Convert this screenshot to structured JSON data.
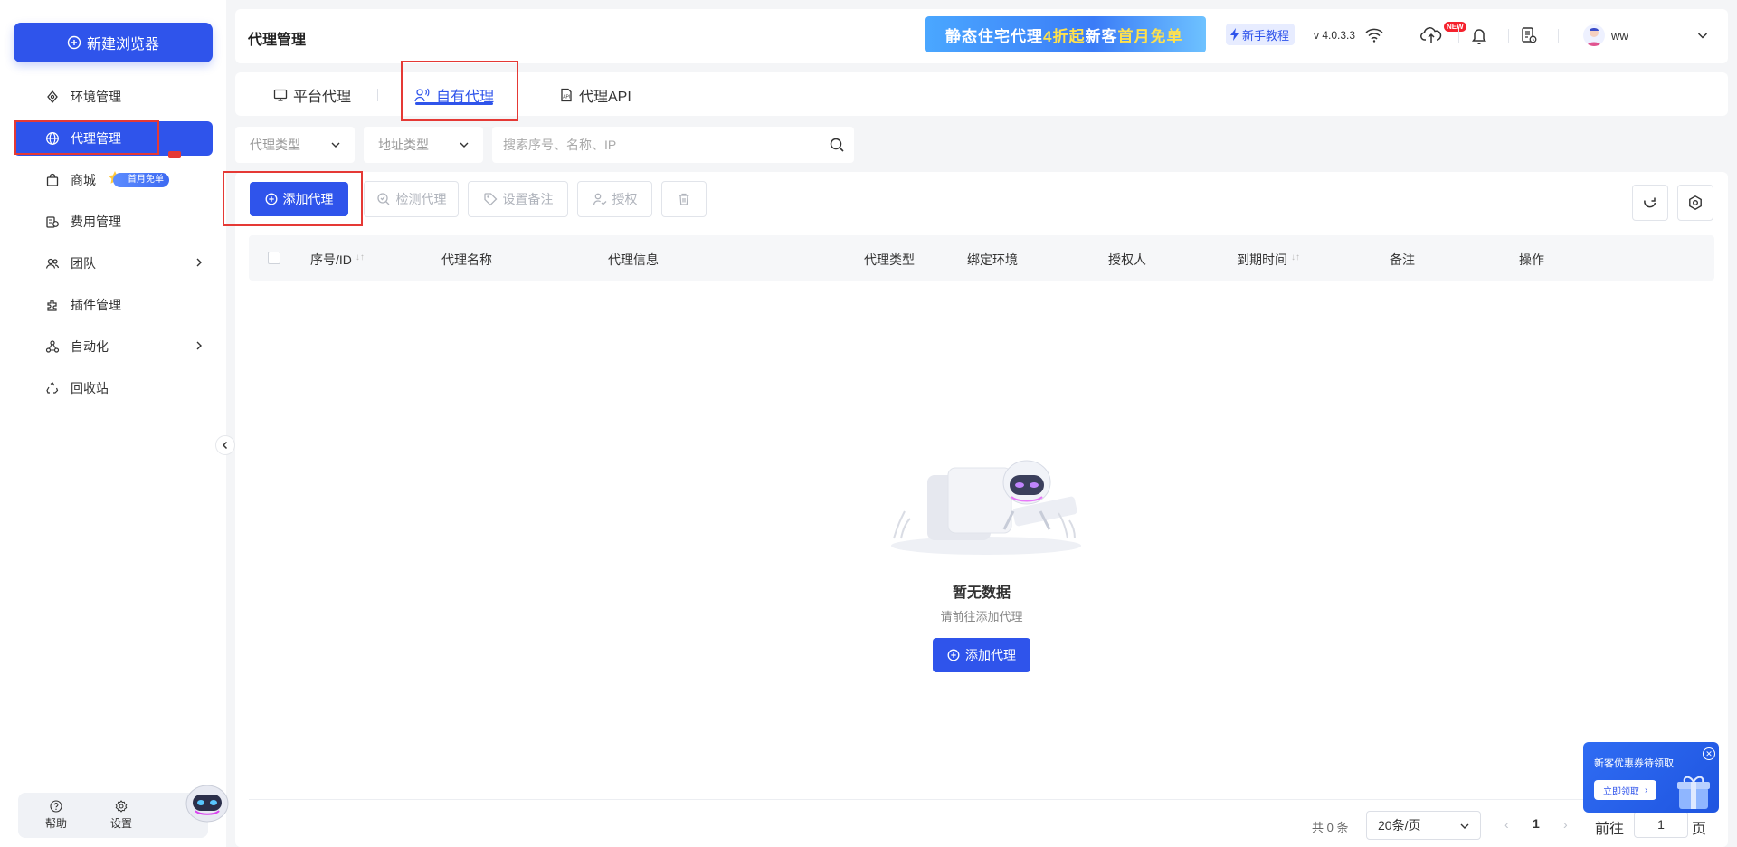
{
  "sidebar": {
    "new_browser_label": "新建浏览器",
    "items": [
      {
        "label": "环境管理",
        "icon": "environment-icon"
      },
      {
        "label": "代理管理",
        "icon": "globe-icon",
        "active": true
      },
      {
        "label": "商城",
        "icon": "shopping-bag-icon",
        "badge": "首月免单"
      },
      {
        "label": "费用管理",
        "icon": "billing-icon"
      },
      {
        "label": "团队",
        "icon": "team-icon",
        "has_submenu": true
      },
      {
        "label": "插件管理",
        "icon": "plugin-icon"
      },
      {
        "label": "自动化",
        "icon": "automation-icon",
        "has_submenu": true
      },
      {
        "label": "回收站",
        "icon": "recycle-icon"
      }
    ],
    "footer": {
      "help_label": "帮助",
      "settings_label": "设置"
    }
  },
  "header": {
    "title": "代理管理",
    "promo": {
      "text_a": "静态住宅代理",
      "text_b": "4折起",
      "text_c": " 新客",
      "text_d": "首月免单"
    },
    "tutorial_label": "新手教程",
    "version": "v 4.0.3.3",
    "new_badge": "NEW",
    "username": "ww"
  },
  "tabs": [
    {
      "label": "平台代理",
      "icon": "monitor-icon"
    },
    {
      "label": "自有代理",
      "icon": "user-signal-icon",
      "active": true
    },
    {
      "label": "代理API",
      "icon": "api-doc-icon"
    }
  ],
  "filters": {
    "proxy_type_placeholder": "代理类型",
    "address_type_placeholder": "地址类型",
    "search_placeholder": "搜索序号、名称、IP"
  },
  "toolbar": {
    "add_proxy": "添加代理",
    "check_proxy": "检测代理",
    "set_note": "设置备注",
    "authorize": "授权"
  },
  "table": {
    "columns": [
      "序号/ID",
      "代理名称",
      "代理信息",
      "代理类型",
      "绑定环境",
      "授权人",
      "到期时间",
      "备注",
      "操作"
    ]
  },
  "empty": {
    "title": "暂无数据",
    "subtitle": "请前往添加代理",
    "button": "添加代理"
  },
  "pagination": {
    "total": "共 0 条",
    "page_size": "20条/页",
    "current_page": "1",
    "goto_prefix": "前往",
    "goto_value": "1",
    "goto_suffix": "页"
  },
  "coupon": {
    "title": "新客优惠券待领取",
    "button": "立即领取"
  },
  "colors": {
    "primary": "#2f54eb",
    "highlight_box": "#e53935"
  }
}
